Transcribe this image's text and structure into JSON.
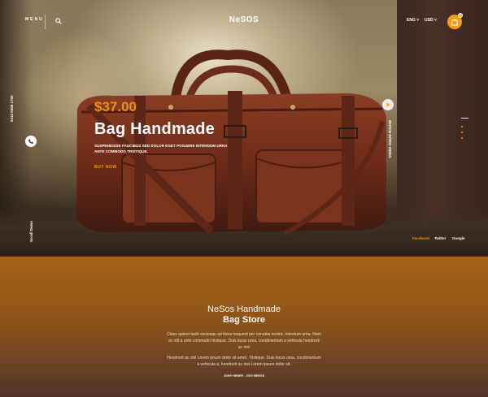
{
  "header": {
    "menu_label": "MENU",
    "search_icon": "search-icon",
    "logo": "NeSOS",
    "currency_1": "ENG",
    "currency_2": "USD",
    "cart_count": "0",
    "cart_icon": "cart-icon"
  },
  "hero": {
    "price": "$37.00",
    "title": "Bag Handmade",
    "description": "Suspendisse faucibus sed dolor eget posuere interdum urna ante commodo tristique.",
    "buy_label": "BUY NOW",
    "phone_text": "0412 6368 1760",
    "phone_icon": "phone-icon",
    "scroll_text": "Scroll Down",
    "watch_text": "WATCH INTRO VIDEO",
    "play_icon": "play-icon",
    "accent": "#f59a1b"
  },
  "social": [
    "Facebook",
    "Twitter",
    "Google"
  ],
  "about": {
    "title_line1": "NeSos Handmade",
    "title_line2": "Bag Store",
    "paragraph1": "Class aptent taciti sociosqu ad litora torquent per conubia nostra. Interdum urna. Nam ac elit a ante commodo tristique. Duis lacus urna, condimentum a vehicula hendrerit ac nisi",
    "paragraph2": "Hendrerit ac nisi Lorem ipsum dolor sit amet. Tristique. Duis lacus urna, condimentum a vehicula a, hendrerit ac nisi Lorem ipsum dolor sit.",
    "signature": "JONY HENRY - CEO NESOS"
  }
}
